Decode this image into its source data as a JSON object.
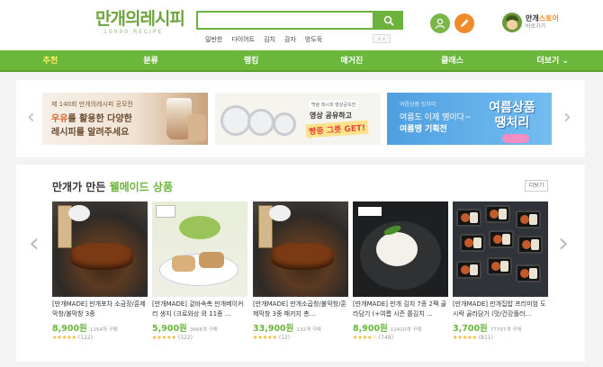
{
  "header": {
    "logo_main": "만개의레시피",
    "logo_sub": "10000 RECIPE",
    "search": {
      "value": "",
      "placeholder": ""
    },
    "keywords": [
      "밀반찬",
      "다이어트",
      "김치",
      "감자",
      "방도둑"
    ],
    "kw_nav": {
      "prev": "‹",
      "next": "›"
    },
    "store": {
      "name_prefix": "만개",
      "name_accent": "스토어",
      "sub": "바로가기"
    }
  },
  "nav": {
    "items": [
      {
        "label": "추천",
        "active": true
      },
      {
        "label": "분류",
        "active": false
      },
      {
        "label": "랭킹",
        "active": false
      },
      {
        "label": "매거진",
        "active": false
      },
      {
        "label": "클래스",
        "active": false
      },
      {
        "label": "더보기 ⌄",
        "active": false
      }
    ]
  },
  "banners": {
    "b1": {
      "top": "제 140회 만개의레시피 공모전",
      "line2_hl": "우유",
      "line2_rest": "를 활용한 다양한",
      "line3": "레시피를 알려주세요"
    },
    "b2": {
      "tag": "백을 레시피 영상공모전",
      "line1": "영상 공유하고",
      "line2": "빵중 그릇 GET!"
    },
    "b3": {
      "line1": "여름상품 맛차미",
      "line2": "여름도 이제 땡이다~",
      "line3": "여름땡 기획전",
      "big1": "여름상품",
      "big2": "땡처리"
    }
  },
  "products": {
    "section_title_prefix": "만개가 만든 ",
    "section_title_accent": "웰메이드 상품",
    "more_label": "더보기",
    "items": [
      {
        "title": "[만개MADE] 만개포차 소금장/훈제막창/불막창 3종",
        "price": "8,900원",
        "sold": "1254개 구매",
        "stars": "★★★★★",
        "count": "(122)"
      },
      {
        "title": "[만개MADE] 겉바속촉 만개베이커리 생지 (크로와상 외 11종 …",
        "price": "5,900원",
        "sold": "3668개 구매",
        "stars": "★★★★★",
        "count": "(322)"
      },
      {
        "title": "[만개MADE] 만개소곱창/불막창/훈제막창 3종 패키지 총…",
        "price": "33,900원",
        "sold": "132개 구매",
        "stars": "★★★★★",
        "count": "(12)"
      },
      {
        "title": "[만개MADE] 만개 김치 7종 2팩 골라담기 (+여름 시즌 쫄김치 …",
        "price": "8,900원",
        "sold": "11410개 구매",
        "stars": "★★★★☆",
        "count": "(749)"
      },
      {
        "title": "[만개MADE] 만개집밥 프리미엄 도시락 골라담기 (맛/건강플러…",
        "price": "3,700원",
        "sold": "77797개 구매",
        "stars": "★★★★★",
        "count": "(811)"
      }
    ]
  },
  "colors": {
    "brand_green": "#6ab73c",
    "accent_orange": "#f18b2a",
    "nav_active": "#fff35c"
  },
  "icons": {
    "search": "search-icon",
    "user": "user-icon",
    "write": "pencil-icon",
    "left": "chevron-left-icon",
    "right": "chevron-right-icon"
  }
}
